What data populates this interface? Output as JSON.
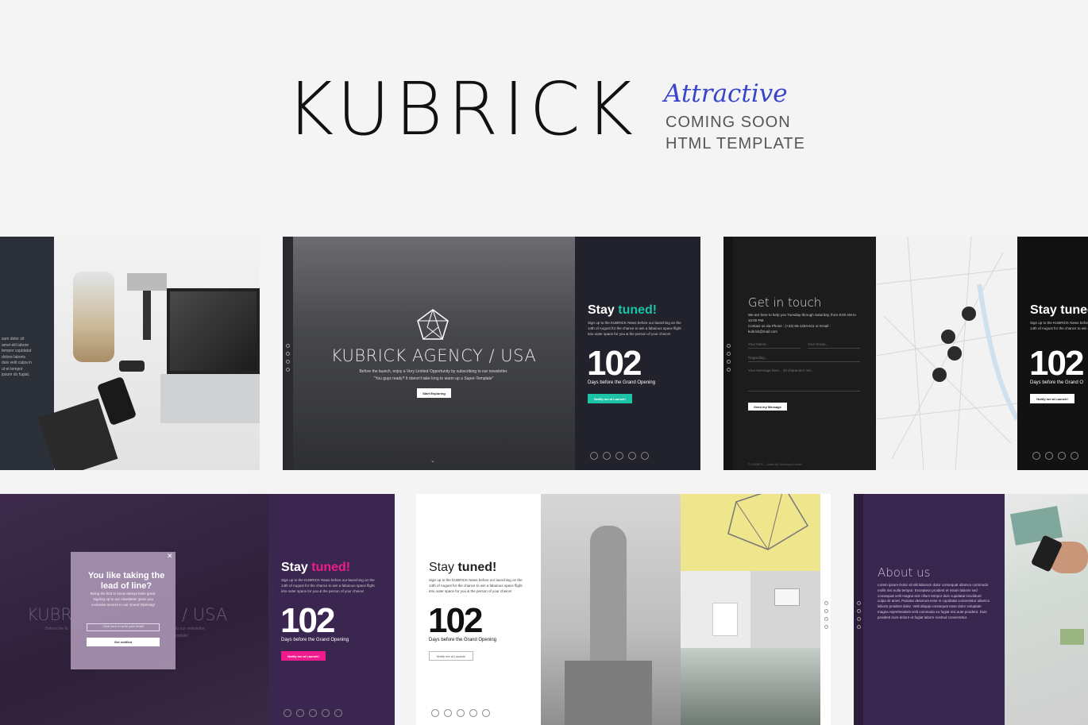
{
  "hero": {
    "title": "KUBRICK",
    "script": "Attractive",
    "line1": "COMING SOON",
    "line2": "HTML TEMPLATE"
  },
  "card2": {
    "headline": "KUBRICK AGENCY / USA",
    "text1": "Before the launch, enjoy a Very Limited Opportunity by subscribing to our newsletter.",
    "text2": "\"You guys ready? It doesn't take long to warm up a Super-Template\"",
    "button": "Start Exploring",
    "stay": "Stay",
    "tuned": "tuned!",
    "blurb": "Sign up to the KUBRICK News before our launching on the 14th of August for the chance to win a fabulous space flight into outer space for you & the person of your choice!",
    "count": "102",
    "count_label": "Days before the Grand Opening",
    "notify": "Notify me at Launch!"
  },
  "card3": {
    "heading": "Get in touch",
    "intro": "We are here to help you Tuesday through Saturday, from 9:00 AM to 10:00 PM.",
    "contact": "Contact us via Phone : (+33) 66-1254-611 or Email : kubrick@mail.com",
    "name_ph": "Your Name...",
    "email_ph": "Your Email...",
    "subject_ph": "Regarding...",
    "message_ph": "Your message here... 20 characters min.",
    "send": "Send my Message",
    "footer": "© KUBRICK — Made by Dominique Fourier",
    "stay": "Stay",
    "tuned": "tuned!",
    "blurb": "Sign up to the KUBRICK News before our launching on the 14th of August for the chance to win a fabulous space flight",
    "count": "102",
    "count_label": "Days before the Grand O",
    "notify": "Notify me at Launch!"
  },
  "card4": {
    "popup_title": "You like taking the lead of line?",
    "popup_text": "Being the first to know always feels great. Signing up to our newsletter gives you exclusive access to our Grand Opening!",
    "popup_ph": "Click here to write your email",
    "popup_btn": "Get notified",
    "bg_text_left": "KUBR",
    "bg_text_right": "/ USA",
    "bg_small_left": "Before the la",
    "bg_small_right": "to our newsletter.",
    "bg_small_right2": "mplate\"",
    "stay": "Stay",
    "tuned": "tuned!",
    "blurb": "Sign up to the KUBRICK News before our launching on the 14th of August for the chance to win a fabulous space flight into outer space for you & the person of your choice!",
    "count": "102",
    "count_label": "Days before the Grand Opening",
    "notify": "Notify me at Launch!"
  },
  "card5": {
    "stay": "Stay",
    "tuned": "tuned!",
    "blurb": "Sign up to the KUBRICK News before our launching on the 14th of August for the chance to win a fabulous space flight into outer space for you & the person of your choice!",
    "count": "102",
    "count_label": "Days before the Grand Opening",
    "notify": "Notify me at Launch!"
  },
  "card6": {
    "heading": "About us",
    "body": "Lorem ipsum Dolor sit elit laborum dolor consequat ullamco commodo mollit nisi nulla tempor. Excepteur proident et minim laboris sed consequat velit magna sint cillum tempor duis cupidatat incididunt culpa sit amet. Pariatur deserunt esse in cupidatat consectetur ullamco laboris proident dolor. Velit aliquip consequat esse dolor voluptate magna reprehenderit velit commodo eu fugiat nisi aute proident. Duis proident irure dolore ut fugiat labore nostrud consectetur."
  },
  "card1": {
    "sidebar_text": "sum dolor sit amet elit labore tempor cupidatat dolore laboris duis velit culpa in ut et tempor ipsum do fugiat."
  },
  "colors": {
    "accent_teal": "#1cc3a6",
    "accent_pink": "#ee1b8c",
    "script_blue": "#3844c9",
    "dark_navy": "#22222c",
    "purple": "#3b2650"
  }
}
